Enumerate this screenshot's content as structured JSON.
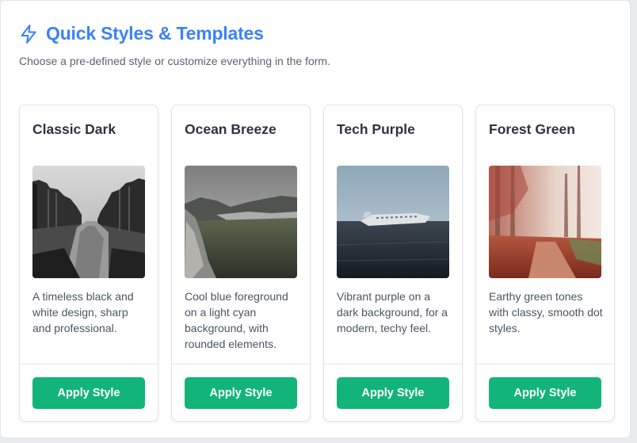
{
  "header": {
    "title": "Quick Styles & Templates",
    "subtitle": "Choose a pre-defined style or customize everything in the form.",
    "icon": "lightning-bolt-icon",
    "accent_color": "#3b82f6"
  },
  "button_color": "#12b47a",
  "templates": [
    {
      "title": "Classic Dark",
      "description": "A timeless black and white design, sharp and professional.",
      "image": "black-and-white canal street photo",
      "button_label": "Apply Style"
    },
    {
      "title": "Ocean Breeze",
      "description": "Cool blue foreground on a light cyan background, with rounded elements.",
      "image": "misty mountain lake landscape photo",
      "button_label": "Apply Style"
    },
    {
      "title": "Tech Purple",
      "description": "Vibrant purple on a dark background, for a modern, techy feel.",
      "image": "plane wreck on black sand beach photo",
      "button_label": "Apply Style"
    },
    {
      "title": "Forest Green",
      "description": "Earthy green tones with classy, smooth dot styles.",
      "image": "autumn forest path photo",
      "button_label": "Apply Style"
    }
  ]
}
